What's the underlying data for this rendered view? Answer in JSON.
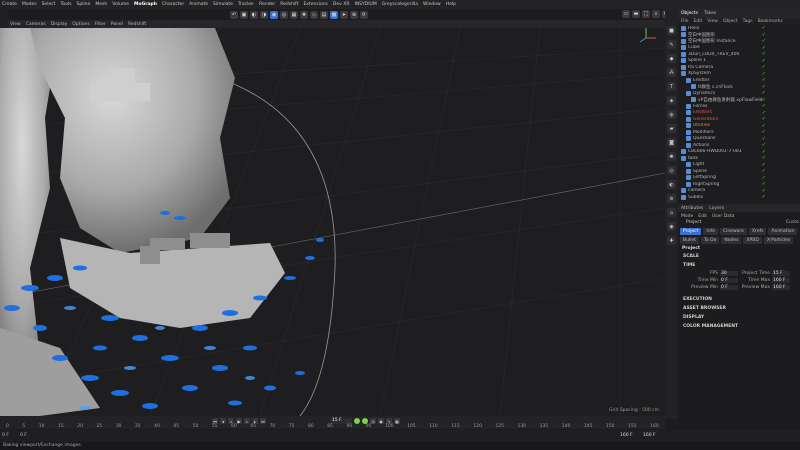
{
  "menubar": [
    "Create",
    "Modes",
    "Select",
    "Tools",
    "Spline",
    "Mesh",
    "Volume",
    "MoGraph",
    "Character",
    "Animate",
    "Simulate",
    "Tracker",
    "Render",
    "Redshift",
    "Extensions",
    "Dev XR",
    "INSYDIUM",
    "Greyscalegorilla",
    "Window",
    "Help"
  ],
  "menubar_active_index": 7,
  "viewport": {
    "menu": [
      "View",
      "Cameras",
      "Display",
      "Options",
      "Filter",
      "Panel",
      "Redshift"
    ],
    "grid_spacing": "Grid Spacing : 500 cm"
  },
  "panel": {
    "tabs": [
      "Objects",
      "Takes"
    ],
    "menu": [
      "File",
      "Edit",
      "View",
      "Object",
      "Tags",
      "Bookmarks"
    ]
  },
  "objects": [
    {
      "name": "Helix",
      "color": "normal"
    },
    {
      "name": "空白中国图形",
      "color": "normal"
    },
    {
      "name": "空白中国图形 Instance",
      "color": "normal"
    },
    {
      "name": "Cube",
      "color": "normal"
    },
    {
      "name": "3Dun_LOD0_TREV_400",
      "color": "normal"
    },
    {
      "name": "Spline 1",
      "color": "normal"
    },
    {
      "name": "RS Camera",
      "color": "normal"
    },
    {
      "name": "XpSystem",
      "color": "normal"
    },
    {
      "name": "Emitter",
      "color": "normal"
    },
    {
      "name": "tt群鱼 c.cnFlock",
      "color": "normal"
    },
    {
      "name": "Dynamics",
      "color": "normal"
    },
    {
      "name": "xP自由群鱼发射器 xpFlowField",
      "color": "normal"
    },
    {
      "name": "Forces",
      "color": "normal"
    },
    {
      "name": "Emitters",
      "color": "red"
    },
    {
      "name": "Generators",
      "color": "red"
    },
    {
      "name": "Utilities",
      "color": "orange"
    },
    {
      "name": "Modifiers",
      "color": "normal"
    },
    {
      "name": "Questions",
      "color": "normal"
    },
    {
      "name": "Actions",
      "color": "normal"
    },
    {
      "name": "CBL666-HWD001-7-003",
      "color": "normal"
    },
    {
      "name": "tank",
      "color": "normal"
    },
    {
      "name": "Light",
      "color": "normal"
    },
    {
      "name": "Spline",
      "color": "normal"
    },
    {
      "name": "LeftSpring",
      "color": "normal"
    },
    {
      "name": "RightSpring",
      "color": "normal"
    },
    {
      "name": "camera",
      "color": "normal"
    },
    {
      "name": "Subdiv",
      "color": "normal"
    }
  ],
  "attributes": {
    "header": [
      "Attributes",
      "Layers"
    ],
    "menu": [
      "Mode",
      "Edit",
      "User Data"
    ],
    "title": "Project",
    "custom": "Custo",
    "tabs": [
      "Project",
      "Info",
      "Cineware",
      "Xrefs",
      "Animation",
      "Bullet",
      "To Do",
      "Nodes",
      "XPBD",
      "X-Particles"
    ],
    "active_tab": 0,
    "section": "Project",
    "groups": {
      "scale": "SCALE",
      "time": "TIME",
      "execution": "EXECUTION",
      "asset_browser": "ASSET BROWSER",
      "display": "DISPLAY",
      "color_management": "COLOR MANAGEMENT"
    },
    "fields": [
      {
        "l1": "FPS",
        "v1": "30",
        "l2": "Project Time",
        "v2": "15 F"
      },
      {
        "l1": "Time Min",
        "v1": "0 F",
        "l2": "Time Max",
        "v2": "160 F"
      },
      {
        "l1": "Preview Min",
        "v1": "0 F",
        "l2": "Preview Max",
        "v2": "160 F"
      }
    ]
  },
  "timeline": {
    "ticks": [
      "0",
      "5",
      "10",
      "15",
      "20",
      "25",
      "30",
      "35",
      "40",
      "45",
      "50",
      "55",
      "60",
      "65",
      "70",
      "75",
      "80",
      "85",
      "90",
      "95",
      "100",
      "105",
      "110",
      "115",
      "120",
      "125",
      "130",
      "135",
      "140",
      "145",
      "150",
      "155",
      "160"
    ],
    "current_frame": "15 F",
    "start": "0 F",
    "start2": "0 F",
    "end1": "160 F",
    "end2": "160 F"
  },
  "status": "Baking viewport/Exchange images"
}
